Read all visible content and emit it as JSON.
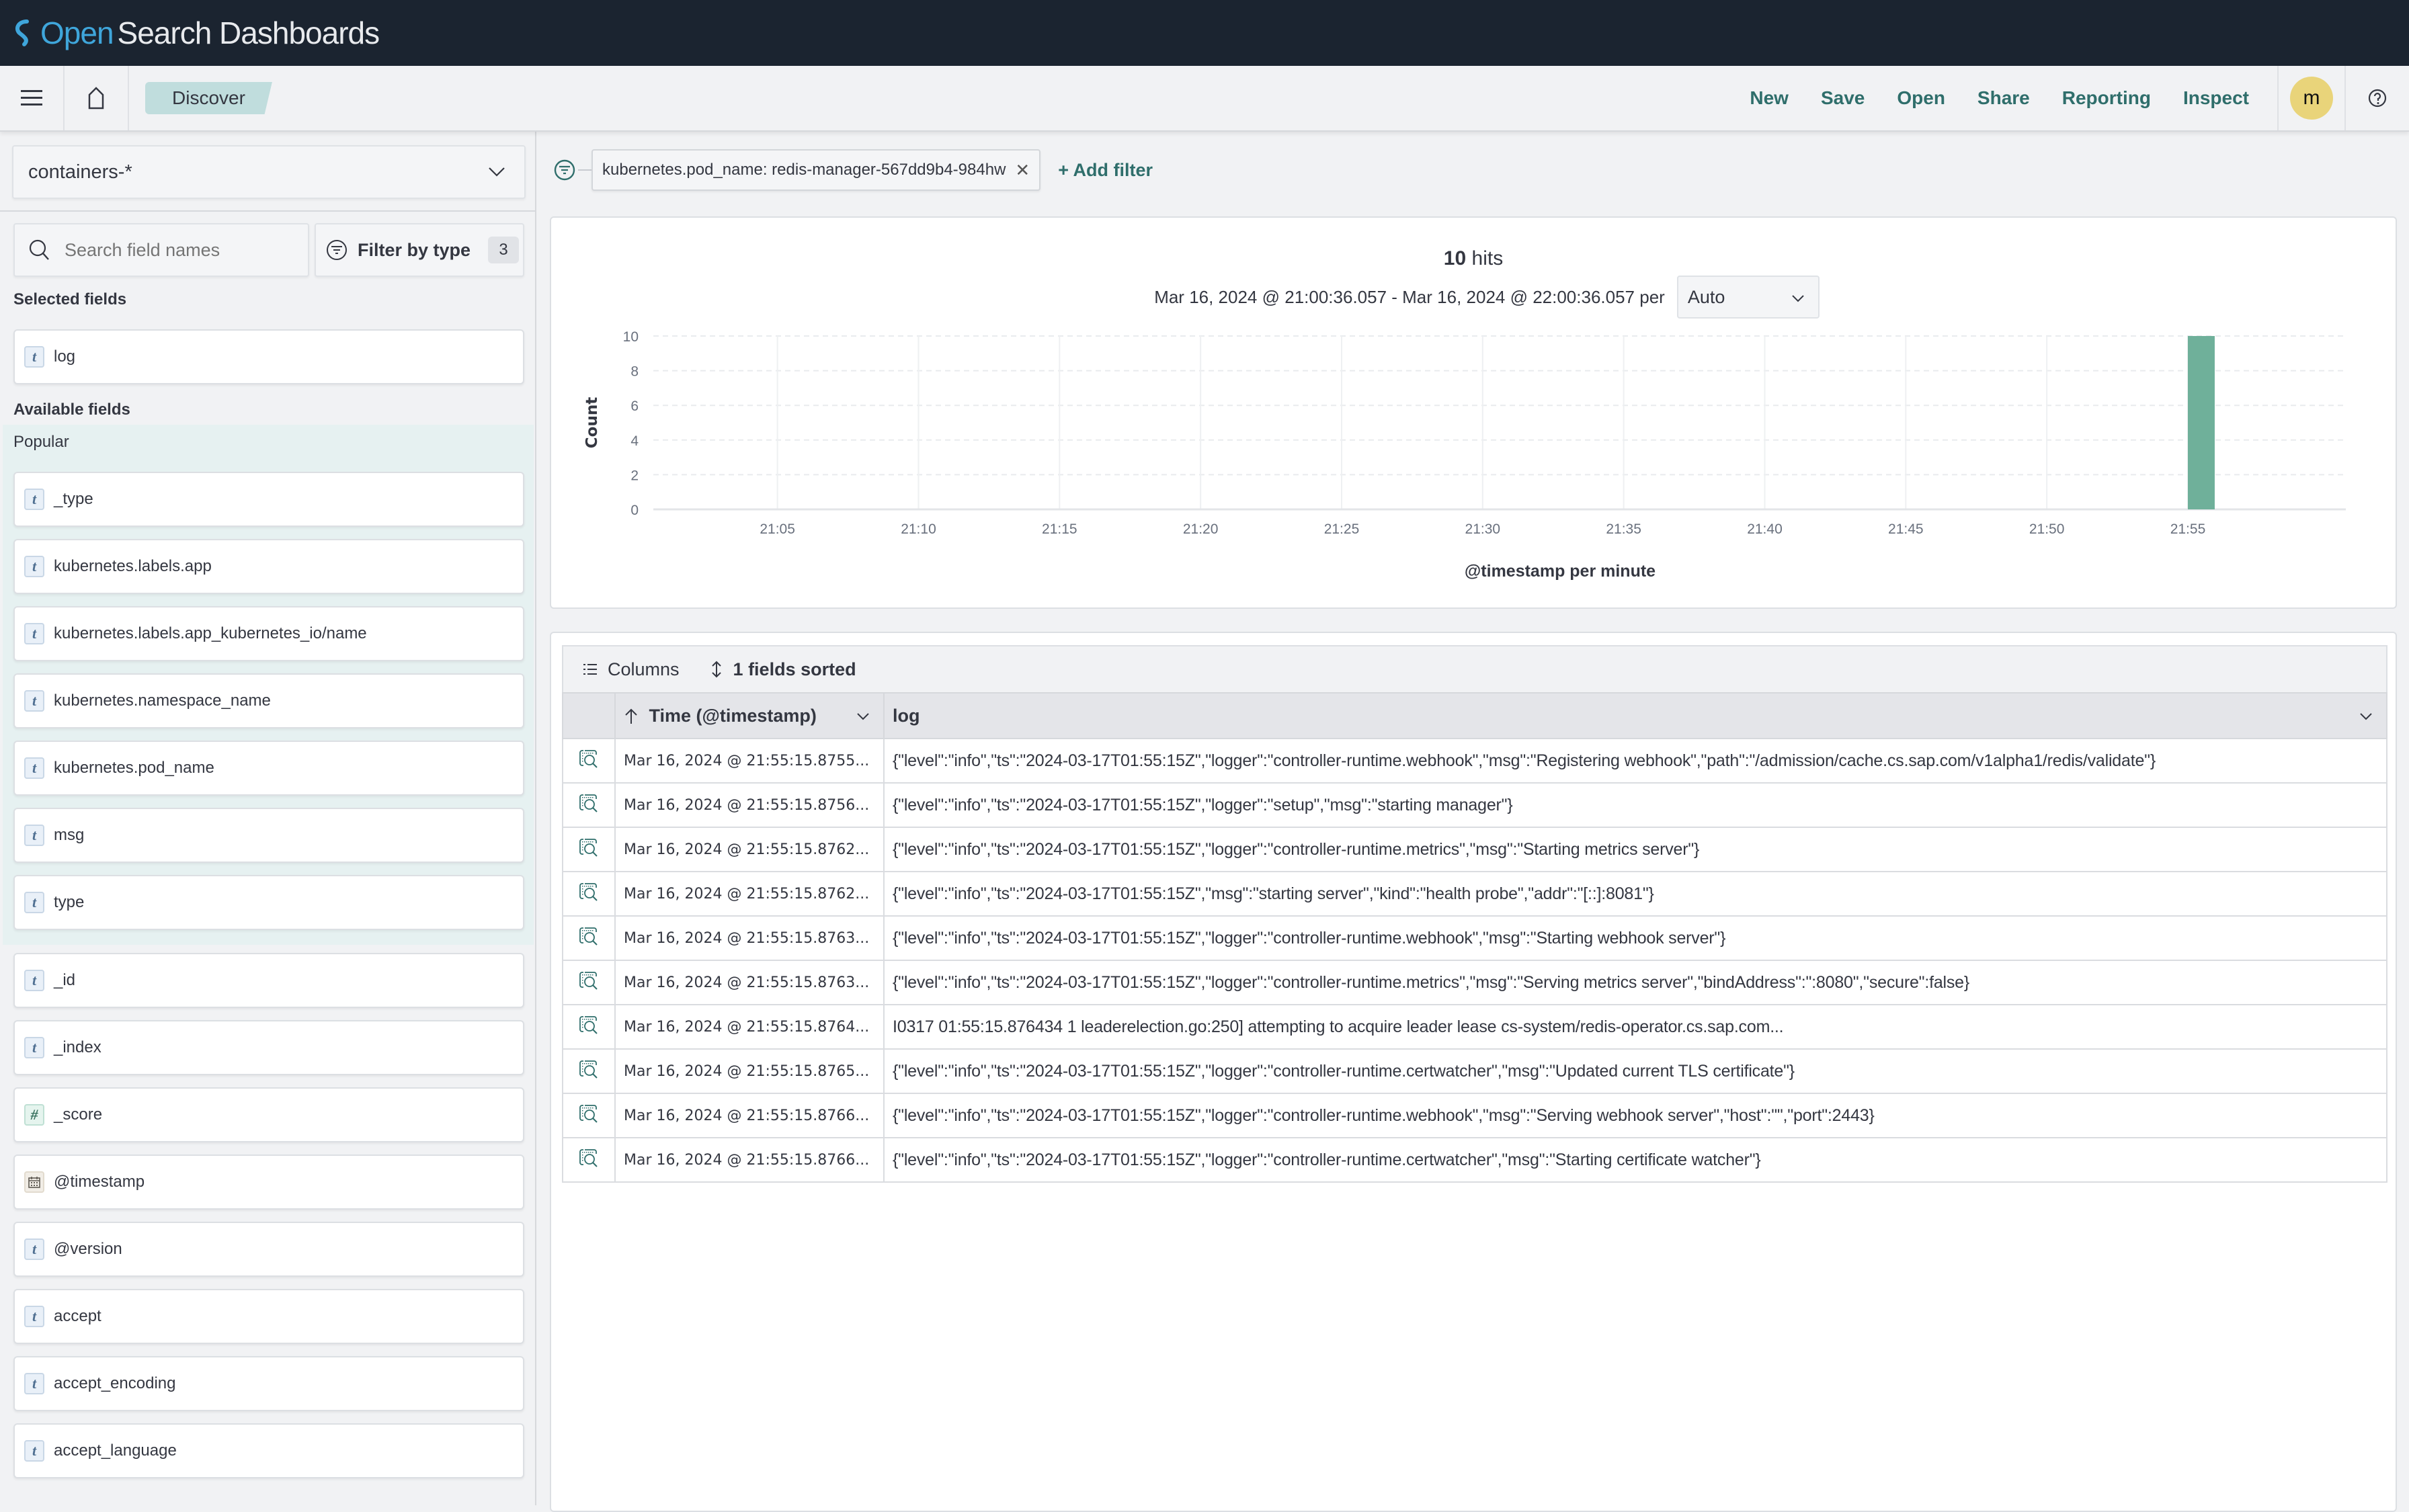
{
  "app": {
    "brand_open": "Open",
    "brand_rest": "Search Dashboards"
  },
  "header": {
    "breadcrumb": "Discover",
    "nav": [
      "New",
      "Save",
      "Open",
      "Share",
      "Reporting",
      "Inspect"
    ],
    "avatar_initial": "m",
    "icons": [
      "menu-icon",
      "home-icon",
      "help-icon"
    ]
  },
  "sidebar": {
    "index_pattern": "containers-*",
    "search_placeholder": "Search field names",
    "filter_by_type_label": "Filter by type",
    "filter_by_type_count": "3",
    "selected_title": "Selected fields",
    "selected_fields": [
      {
        "name": "log",
        "type": "t"
      }
    ],
    "available_title": "Available fields",
    "popular_label": "Popular",
    "popular_fields": [
      {
        "name": "_type",
        "type": "t"
      },
      {
        "name": "kubernetes.labels.app",
        "type": "t"
      },
      {
        "name": "kubernetes.labels.app_kubernetes_io/name",
        "type": "t"
      },
      {
        "name": "kubernetes.namespace_name",
        "type": "t"
      },
      {
        "name": "kubernetes.pod_name",
        "type": "t"
      },
      {
        "name": "msg",
        "type": "t"
      },
      {
        "name": "type",
        "type": "t"
      }
    ],
    "other_fields": [
      {
        "name": "_id",
        "type": "t"
      },
      {
        "name": "_index",
        "type": "t"
      },
      {
        "name": "_score",
        "type": "#"
      },
      {
        "name": "@timestamp",
        "type": "date"
      },
      {
        "name": "@version",
        "type": "t"
      },
      {
        "name": "accept",
        "type": "t"
      },
      {
        "name": "accept_encoding",
        "type": "t"
      },
      {
        "name": "accept_language",
        "type": "t"
      }
    ]
  },
  "filters": {
    "active": [
      {
        "label": "kubernetes.pod_name: redis-manager-567dd9b4-984hw"
      }
    ],
    "add_filter_label": "+ Add filter"
  },
  "histogram": {
    "hits_count": "10",
    "hits_label": "hits",
    "range_text": "Mar 16, 2024 @ 21:00:36.057 - Mar 16, 2024 @ 22:00:36.057 per",
    "interval": "Auto"
  },
  "chart_data": {
    "type": "bar",
    "title": "",
    "xlabel": "@timestamp per minute",
    "ylabel": "Count",
    "ylim": [
      0,
      10
    ],
    "yticks": [
      0,
      2,
      4,
      6,
      8,
      10
    ],
    "xlim": [
      "21:00:36",
      "22:00:36"
    ],
    "xticks": [
      "21:05",
      "21:10",
      "21:15",
      "21:20",
      "21:25",
      "21:30",
      "21:35",
      "21:40",
      "21:45",
      "21:50",
      "21:55"
    ],
    "grid": true,
    "color": "#6fb09a",
    "categories": [
      "21:55"
    ],
    "values": [
      10
    ]
  },
  "table": {
    "columns_label": "Columns",
    "sorted_label": "1 fields sorted",
    "headers": {
      "time": "Time (@timestamp)",
      "log": "log"
    },
    "rows": [
      {
        "time": "Mar 16, 2024 @ 21:55:15.8755...",
        "log": "{\"level\":\"info\",\"ts\":\"2024-03-17T01:55:15Z\",\"logger\":\"controller-runtime.webhook\",\"msg\":\"Registering webhook\",\"path\":\"/admission/cache.cs.sap.com/v1alpha1/redis/validate\"}"
      },
      {
        "time": "Mar 16, 2024 @ 21:55:15.8756...",
        "log": "{\"level\":\"info\",\"ts\":\"2024-03-17T01:55:15Z\",\"logger\":\"setup\",\"msg\":\"starting manager\"}"
      },
      {
        "time": "Mar 16, 2024 @ 21:55:15.8762...",
        "log": "{\"level\":\"info\",\"ts\":\"2024-03-17T01:55:15Z\",\"logger\":\"controller-runtime.metrics\",\"msg\":\"Starting metrics server\"}"
      },
      {
        "time": "Mar 16, 2024 @ 21:55:15.8762...",
        "log": "{\"level\":\"info\",\"ts\":\"2024-03-17T01:55:15Z\",\"msg\":\"starting server\",\"kind\":\"health probe\",\"addr\":\"[::]:8081\"}"
      },
      {
        "time": "Mar 16, 2024 @ 21:55:15.8763...",
        "log": "{\"level\":\"info\",\"ts\":\"2024-03-17T01:55:15Z\",\"logger\":\"controller-runtime.webhook\",\"msg\":\"Starting webhook server\"}"
      },
      {
        "time": "Mar 16, 2024 @ 21:55:15.8763...",
        "log": "{\"level\":\"info\",\"ts\":\"2024-03-17T01:55:15Z\",\"logger\":\"controller-runtime.metrics\",\"msg\":\"Serving metrics server\",\"bindAddress\":\":8080\",\"secure\":false}"
      },
      {
        "time": "Mar 16, 2024 @ 21:55:15.8764...",
        "log": "I0317 01:55:15.876434 1 leaderelection.go:250] attempting to acquire leader lease cs-system/redis-operator.cs.sap.com..."
      },
      {
        "time": "Mar 16, 2024 @ 21:55:15.8765...",
        "log": "{\"level\":\"info\",\"ts\":\"2024-03-17T01:55:15Z\",\"logger\":\"controller-runtime.certwatcher\",\"msg\":\"Updated current TLS certificate\"}"
      },
      {
        "time": "Mar 16, 2024 @ 21:55:15.8766...",
        "log": "{\"level\":\"info\",\"ts\":\"2024-03-17T01:55:15Z\",\"logger\":\"controller-runtime.webhook\",\"msg\":\"Serving webhook server\",\"host\":\"\",\"port\":2443}"
      },
      {
        "time": "Mar 16, 2024 @ 21:55:15.8766...",
        "log": "{\"level\":\"info\",\"ts\":\"2024-03-17T01:55:15Z\",\"logger\":\"controller-runtime.certwatcher\",\"msg\":\"Starting certificate watcher\"}"
      }
    ]
  },
  "colors": {
    "header_bg": "#1b2430",
    "accent": "#2f6e6b",
    "bar": "#6fb09a",
    "avatar": "#e9d47a",
    "breadcrumb": "#c0dddd"
  }
}
